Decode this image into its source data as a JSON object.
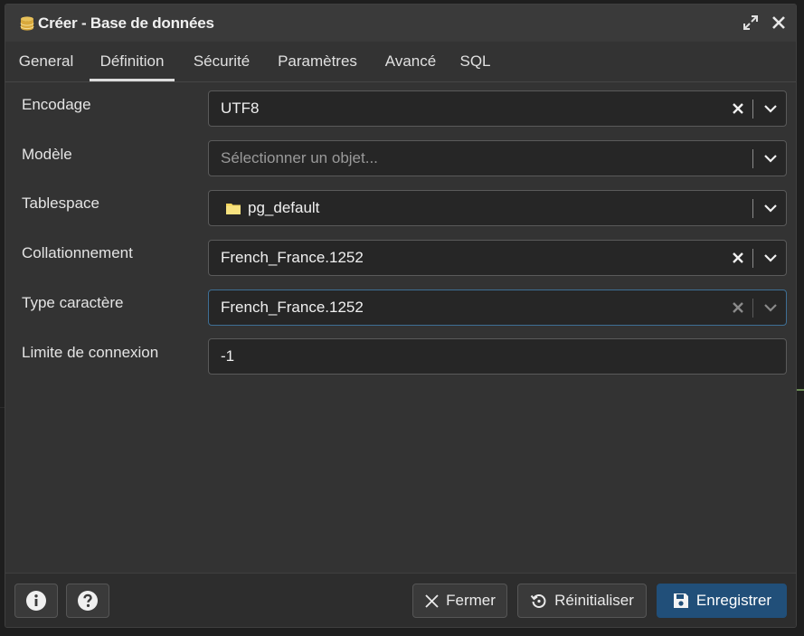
{
  "window": {
    "title": "Créer - Base de données",
    "icons": [
      "database-icon",
      "expand-icon",
      "close-icon"
    ]
  },
  "tabs": [
    {
      "label": "General",
      "active": false
    },
    {
      "label": "Définition",
      "active": true
    },
    {
      "label": "Sécurité",
      "active": false
    },
    {
      "label": "Paramètres",
      "active": false
    },
    {
      "label": "Avancé",
      "active": false
    },
    {
      "label": "SQL",
      "active": false
    }
  ],
  "form": {
    "encoding": {
      "label": "Encodage",
      "value": "UTF8"
    },
    "template": {
      "label": "Modèle",
      "placeholder": "Sélectionner un objet..."
    },
    "tablespace": {
      "label": "Tablespace",
      "value": "pg_default",
      "icon": "folder-icon"
    },
    "collation": {
      "label": "Collationnement",
      "value": "French_France.1252"
    },
    "ctype": {
      "label": "Type caractère",
      "value": "French_France.1252"
    },
    "connection_limit": {
      "label": "Limite de connexion",
      "value": "-1"
    }
  },
  "footer": {
    "info_icon": "info-icon",
    "help_icon": "help-icon",
    "close_label": "Fermer",
    "reset_label": "Réinitialiser",
    "save_label": "Enregistrer"
  },
  "colors": {
    "background": "#333333",
    "primary_button": "#214f79",
    "focus_border": "#3e6f95"
  }
}
